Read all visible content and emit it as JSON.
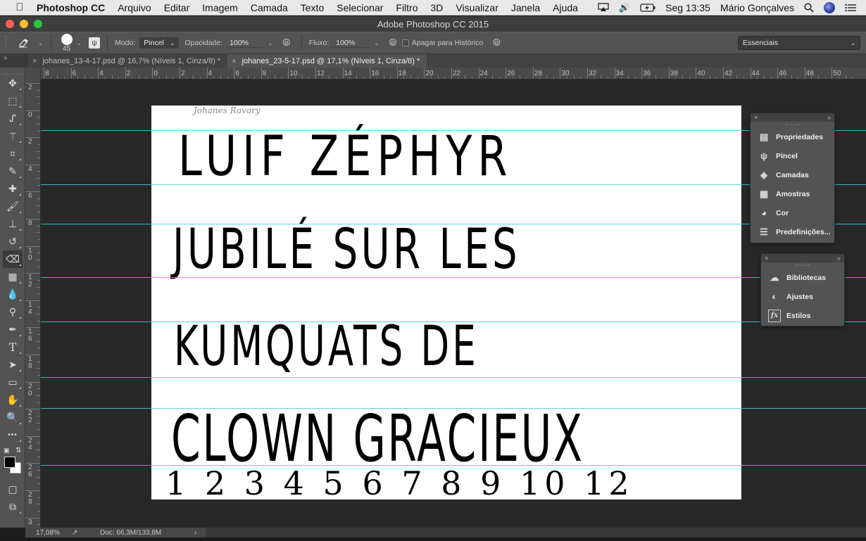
{
  "menubar": {
    "app_name": "Photoshop CC",
    "items": [
      "Arquivo",
      "Editar",
      "Imagem",
      "Camada",
      "Texto",
      "Selecionar",
      "Filtro",
      "3D",
      "Visualizar",
      "Janela",
      "Ajuda"
    ],
    "clock": "Seg 13:35",
    "user": "Mário Gonçalves",
    "icons": [
      "apple-icon",
      "airplay-icon",
      "volume-icon",
      "battery-icon",
      "spotlight-icon",
      "siri-icon",
      "notification-center-icon"
    ]
  },
  "window": {
    "title": "Adobe Photoshop CC 2015"
  },
  "options_bar": {
    "brush_size": "45",
    "mode_label": "Modo:",
    "mode_value": "Pincel",
    "opacity_label": "Opacidade:",
    "opacity_value": "100%",
    "flow_label": "Fluxo:",
    "flow_value": "100%",
    "erase_history_label": "Apagar para Histórico",
    "erase_history_checked": false,
    "workspace": "Essenciais"
  },
  "tabs": [
    {
      "label": "johanes_13-4-17.psd @ 16,7% (Níveis 1, Cinza/8) *",
      "active": false
    },
    {
      "label": "johanes_23-5-17.psd @ 17,1% (Níveis 1, Cinza/8) *",
      "active": true
    }
  ],
  "tools": [
    {
      "name": "move-tool",
      "glyph": "✥"
    },
    {
      "name": "marquee-tool",
      "glyph": "⬚"
    },
    {
      "name": "lasso-tool",
      "glyph": "ᔑ"
    },
    {
      "name": "magic-wand-tool",
      "glyph": "⚚"
    },
    {
      "name": "crop-tool",
      "glyph": "⌗"
    },
    {
      "name": "eyedropper-tool",
      "glyph": "✎"
    },
    {
      "name": "healing-brush-tool",
      "glyph": "✚"
    },
    {
      "name": "brush-tool",
      "glyph": "🖌"
    },
    {
      "name": "clone-stamp-tool",
      "glyph": "⊥"
    },
    {
      "name": "history-brush-tool",
      "glyph": "↺"
    },
    {
      "name": "eraser-tool",
      "glyph": "⌫",
      "active": true
    },
    {
      "name": "gradient-tool",
      "glyph": "▦"
    },
    {
      "name": "blur-tool",
      "glyph": "💧"
    },
    {
      "name": "dodge-tool",
      "glyph": "⚲"
    },
    {
      "name": "pen-tool",
      "glyph": "✒"
    },
    {
      "name": "type-tool",
      "glyph": "T"
    },
    {
      "name": "path-selection-tool",
      "glyph": "➤"
    },
    {
      "name": "rectangle-tool",
      "glyph": "▭"
    },
    {
      "name": "hand-tool",
      "glyph": "✋"
    },
    {
      "name": "zoom-tool",
      "glyph": "🔍"
    },
    {
      "name": "edit-toolbar",
      "glyph": "•••"
    }
  ],
  "colors": {
    "foreground": "#000000",
    "background": "#ffffff",
    "guide": "#3fd0d8"
  },
  "ruler": {
    "h_labels": [
      "8",
      "6",
      "4",
      "2",
      "0",
      "2",
      "4",
      "6",
      "8",
      "10",
      "12",
      "14",
      "16",
      "18",
      "20",
      "22",
      "24",
      "26",
      "28",
      "30",
      "32",
      "34",
      "36",
      "38",
      "40",
      "42",
      "44",
      "46",
      "48",
      "50"
    ],
    "v_labels": [
      "2",
      "0",
      "2",
      "4",
      "6",
      "8",
      "10",
      "12",
      "14",
      "16",
      "18",
      "20",
      "22",
      "24",
      "26",
      "28",
      "3"
    ]
  },
  "document": {
    "signature": "Johanes Ravary",
    "lines": [
      "LUIF ZÉPHYR",
      "JUBILÉ SUR LES",
      "KUMQUATS DE",
      "CLOWN GRACIEUX"
    ],
    "numbers": "1 2 3 4 5 6 7 8 9 10 12"
  },
  "panels": {
    "group1": [
      {
        "label": "Propriedades",
        "icon": "properties-icon",
        "glyph": "▤"
      },
      {
        "label": "Pincel",
        "icon": "brush-panel-icon",
        "glyph": "ψ"
      },
      {
        "label": "Camadas",
        "icon": "layers-icon",
        "glyph": "◈"
      },
      {
        "label": "Amostras",
        "icon": "swatches-icon",
        "glyph": "▦"
      },
      {
        "label": "Cor",
        "icon": "color-palette-icon",
        "glyph": "◕"
      },
      {
        "label": "Predefinições...",
        "icon": "tool-presets-icon",
        "glyph": "☰"
      }
    ],
    "group2": [
      {
        "label": "Bibliotecas",
        "icon": "libraries-icon",
        "glyph": "☁"
      },
      {
        "label": "Ajustes",
        "icon": "adjustments-icon",
        "glyph": "◐"
      },
      {
        "label": "Estilos",
        "icon": "styles-icon",
        "glyph": "fx"
      }
    ]
  },
  "status": {
    "zoom": "17,08%",
    "doc_info": "Doc: 66,3M/133,8M"
  }
}
